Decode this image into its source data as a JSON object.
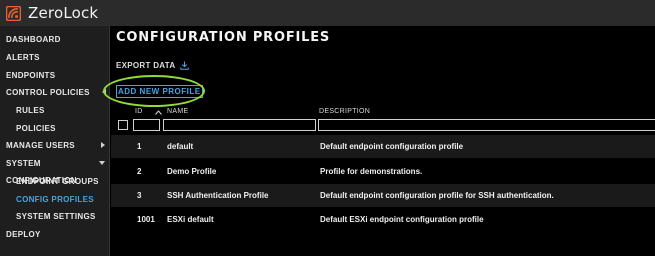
{
  "app": {
    "name": "ZeroLock"
  },
  "sidebar": {
    "items": [
      {
        "label": "DASHBOARD"
      },
      {
        "label": "ALERTS"
      },
      {
        "label": "ENDPOINTS"
      },
      {
        "label": "CONTROL POLICIES"
      },
      {
        "label": "RULES"
      },
      {
        "label": "POLICIES"
      },
      {
        "label": "MANAGE USERS"
      },
      {
        "label": "SYSTEM CONFIGURATION"
      },
      {
        "label": "ENDPOINT GROUPS"
      },
      {
        "label": "CONFIG PROFILES"
      },
      {
        "label": "SYSTEM SETTINGS"
      },
      {
        "label": "DEPLOY"
      }
    ]
  },
  "main": {
    "title": "CONFIGURATION PROFILES",
    "export_label": "EXPORT DATA",
    "add_label": "ADD NEW PROFILE"
  },
  "table": {
    "headers": {
      "id": "ID",
      "name": "NAME",
      "description": "DESCRIPTION"
    },
    "rows": [
      {
        "id": "1",
        "name": "default",
        "description": "Default endpoint configuration profile"
      },
      {
        "id": "2",
        "name": "Demo Profile",
        "description": "Profile for demonstrations."
      },
      {
        "id": "3",
        "name": "SSH Authentication Profile",
        "description": "Default endpoint configuration profile for SSH authentication."
      },
      {
        "id": "1001",
        "name": "ESXi default",
        "description": "Default ESXi endpoint configuration profile"
      }
    ]
  },
  "colors": {
    "accent": "#4aa3e0",
    "highlight": "#8fdc3a",
    "brand": "#e8622c"
  }
}
